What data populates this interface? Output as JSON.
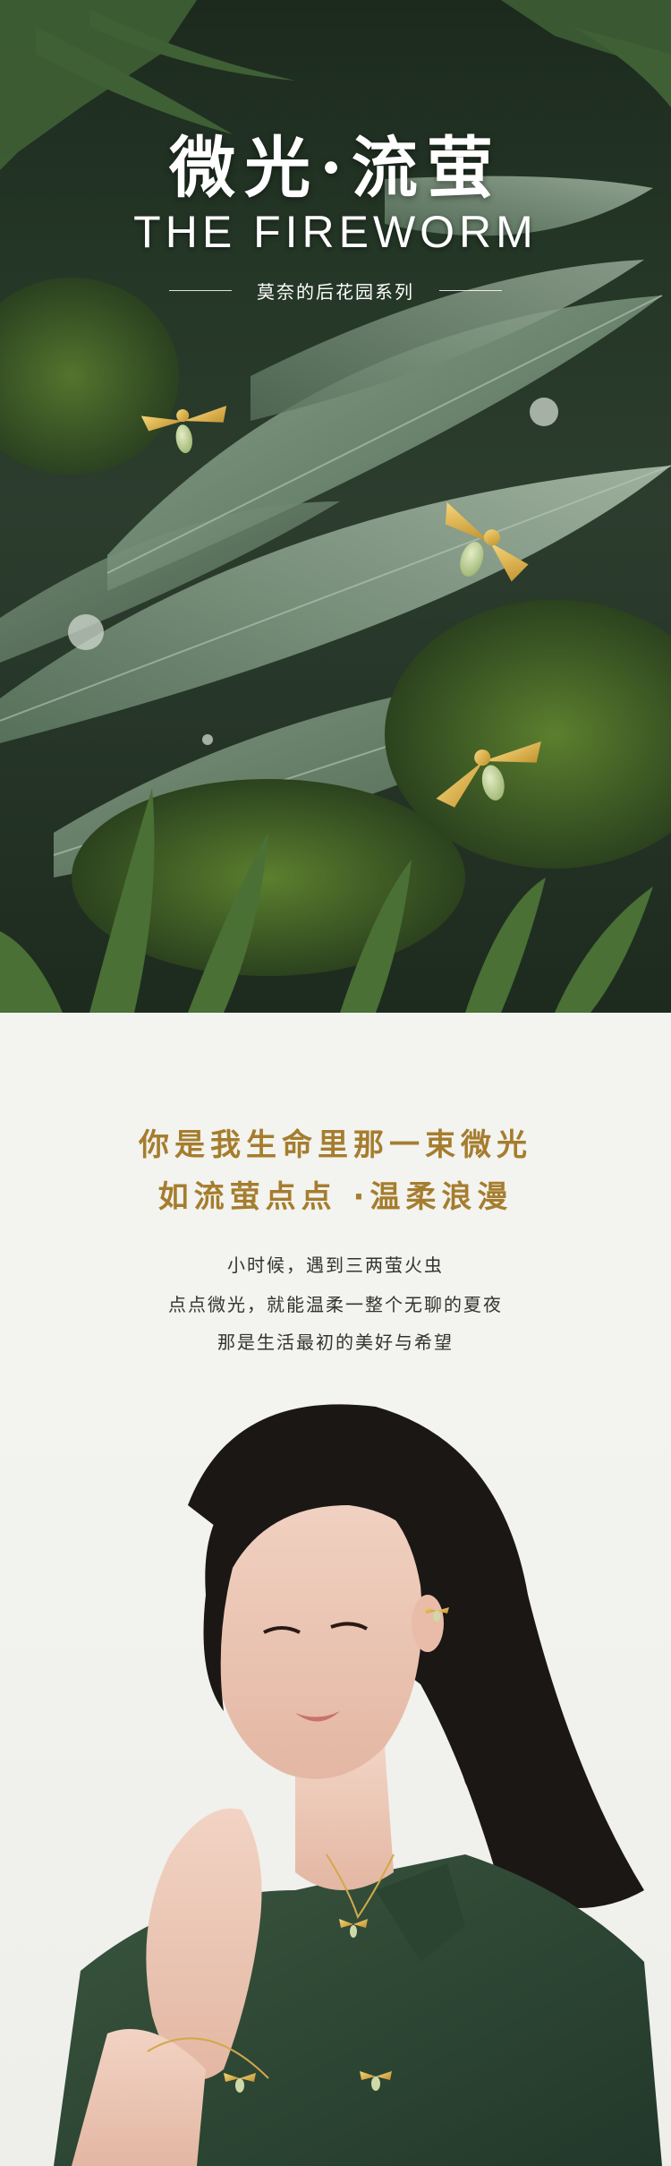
{
  "hero": {
    "title": "微光·流萤",
    "subtitle": "THE FIREWORM",
    "tagline": "莫奈的后花园系列"
  },
  "story": {
    "headline_line1": "你是我生命里那一束微光",
    "headline_line2": "如流萤点点 ·温柔浪漫",
    "body_lines": [
      "小时候，遇到三两萤火虫",
      "点点微光，就能温柔一整个无聊的夏夜",
      "那是生活最初的美好与希望"
    ]
  },
  "colors": {
    "accent_gold": "#a57d2e",
    "forest_green": "#2c3d2e",
    "leaf_green": "#6f8a72",
    "jade": "#b7c98c",
    "shirt_green": "#2f4a37"
  },
  "icons": {
    "firefly": "firefly-earring-icon"
  }
}
